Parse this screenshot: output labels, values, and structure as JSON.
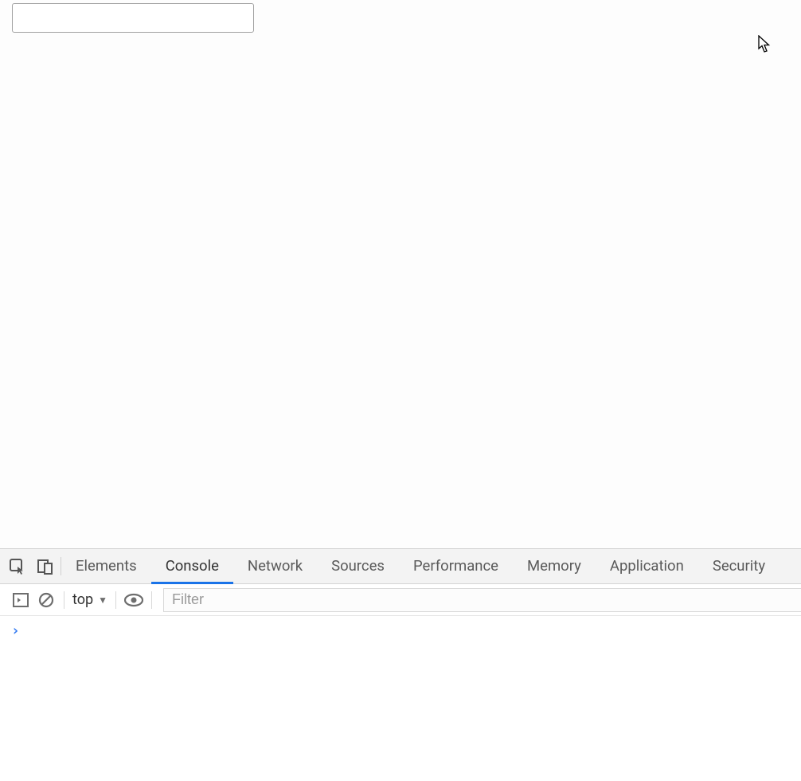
{
  "page": {
    "input_value": ""
  },
  "devtools": {
    "tabs": {
      "elements": "Elements",
      "console": "Console",
      "network": "Network",
      "sources": "Sources",
      "performance": "Performance",
      "memory": "Memory",
      "application": "Application",
      "security": "Security"
    },
    "active_tab": "console"
  },
  "console": {
    "context": "top",
    "filter_placeholder": "Filter",
    "filter_value": ""
  }
}
